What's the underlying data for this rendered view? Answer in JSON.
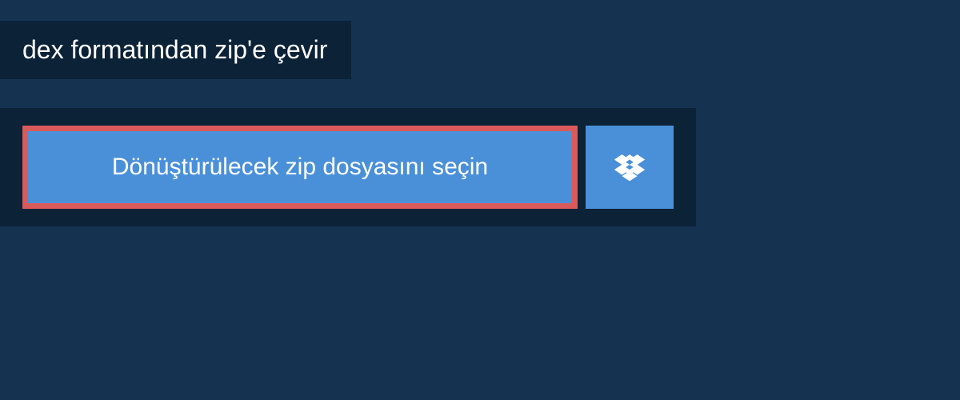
{
  "header": {
    "title": "dex formatından zip'e çevir"
  },
  "upload": {
    "select_file_label": "Dönüştürülecek zip dosyasını seçin"
  },
  "colors": {
    "background": "#153250",
    "panel": "#0c2237",
    "button": "#4a90d9",
    "button_border": "#d95a5a",
    "text": "#ffffff"
  }
}
